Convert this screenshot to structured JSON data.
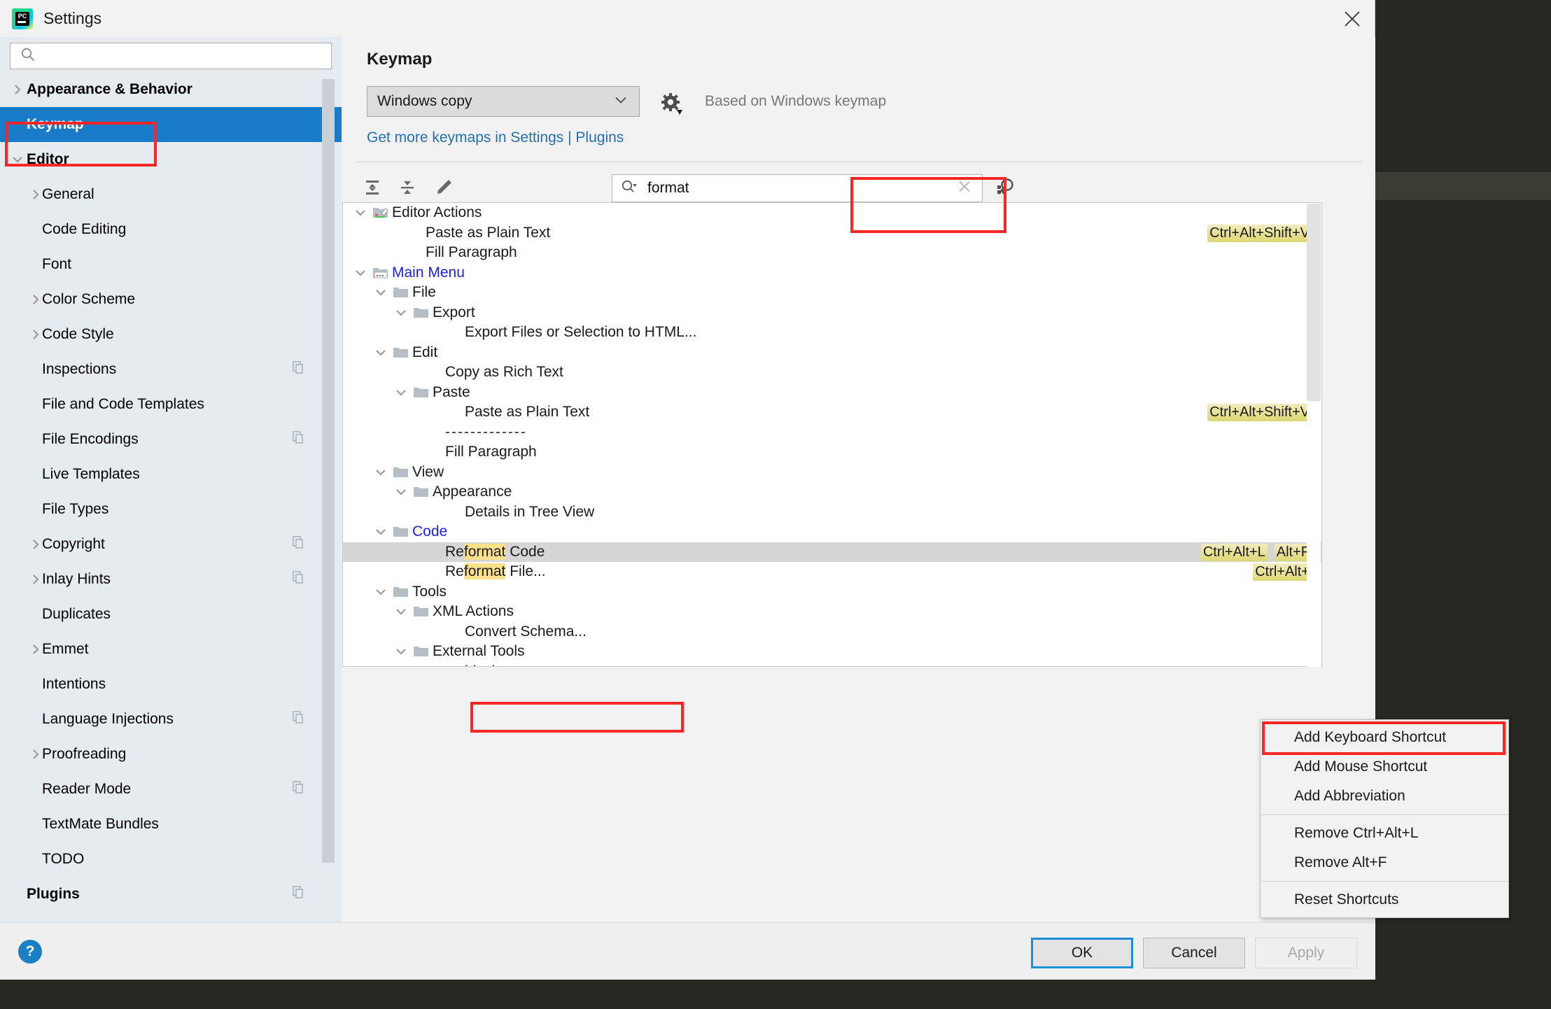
{
  "window": {
    "title": "Settings",
    "logo_text": "PC",
    "close_icon": "close-icon"
  },
  "sidebar": {
    "search": {
      "value": "",
      "placeholder": ""
    },
    "items": [
      {
        "label": "Appearance & Behavior",
        "depth": 0,
        "arrow": "right",
        "bold": true,
        "selected": false,
        "copy": false
      },
      {
        "label": "Keymap",
        "depth": 0,
        "arrow": "none",
        "bold": true,
        "selected": true,
        "copy": false
      },
      {
        "label": "Editor",
        "depth": 0,
        "arrow": "down",
        "bold": true,
        "selected": false,
        "copy": false
      },
      {
        "label": "General",
        "depth": 1,
        "arrow": "right",
        "bold": false,
        "selected": false,
        "copy": false
      },
      {
        "label": "Code Editing",
        "depth": 1,
        "arrow": "none",
        "bold": false,
        "selected": false,
        "copy": false
      },
      {
        "label": "Font",
        "depth": 1,
        "arrow": "none",
        "bold": false,
        "selected": false,
        "copy": false
      },
      {
        "label": "Color Scheme",
        "depth": 1,
        "arrow": "right",
        "bold": false,
        "selected": false,
        "copy": false
      },
      {
        "label": "Code Style",
        "depth": 1,
        "arrow": "right",
        "bold": false,
        "selected": false,
        "copy": false
      },
      {
        "label": "Inspections",
        "depth": 1,
        "arrow": "none",
        "bold": false,
        "selected": false,
        "copy": true
      },
      {
        "label": "File and Code Templates",
        "depth": 1,
        "arrow": "none",
        "bold": false,
        "selected": false,
        "copy": false
      },
      {
        "label": "File Encodings",
        "depth": 1,
        "arrow": "none",
        "bold": false,
        "selected": false,
        "copy": true
      },
      {
        "label": "Live Templates",
        "depth": 1,
        "arrow": "none",
        "bold": false,
        "selected": false,
        "copy": false
      },
      {
        "label": "File Types",
        "depth": 1,
        "arrow": "none",
        "bold": false,
        "selected": false,
        "copy": false
      },
      {
        "label": "Copyright",
        "depth": 1,
        "arrow": "right",
        "bold": false,
        "selected": false,
        "copy": true
      },
      {
        "label": "Inlay Hints",
        "depth": 1,
        "arrow": "right",
        "bold": false,
        "selected": false,
        "copy": true
      },
      {
        "label": "Duplicates",
        "depth": 1,
        "arrow": "none",
        "bold": false,
        "selected": false,
        "copy": false
      },
      {
        "label": "Emmet",
        "depth": 1,
        "arrow": "right",
        "bold": false,
        "selected": false,
        "copy": false
      },
      {
        "label": "Intentions",
        "depth": 1,
        "arrow": "none",
        "bold": false,
        "selected": false,
        "copy": false
      },
      {
        "label": "Language Injections",
        "depth": 1,
        "arrow": "none",
        "bold": false,
        "selected": false,
        "copy": true
      },
      {
        "label": "Proofreading",
        "depth": 1,
        "arrow": "right",
        "bold": false,
        "selected": false,
        "copy": false
      },
      {
        "label": "Reader Mode",
        "depth": 1,
        "arrow": "none",
        "bold": false,
        "selected": false,
        "copy": true
      },
      {
        "label": "TextMate Bundles",
        "depth": 1,
        "arrow": "none",
        "bold": false,
        "selected": false,
        "copy": false
      },
      {
        "label": "TODO",
        "depth": 1,
        "arrow": "none",
        "bold": false,
        "selected": false,
        "copy": false
      },
      {
        "label": "Plugins",
        "depth": 0,
        "arrow": "none",
        "bold": true,
        "selected": false,
        "copy": true
      }
    ]
  },
  "main": {
    "page_title": "Keymap",
    "keymap_select": {
      "value": "Windows copy"
    },
    "gear_icon": "gear-icon",
    "based_on": "Based on Windows keymap",
    "plugins_link": "Get more keymaps in Settings | Plugins",
    "toolbar": {
      "expand_all": "expand-all-icon",
      "collapse_all": "collapse-all-icon",
      "edit": "edit-pencil-icon"
    },
    "search": {
      "value": "format",
      "placeholder": ""
    },
    "find_icon": "find-action-icon",
    "tree": [
      {
        "label": "Editor Actions",
        "depth": 0,
        "arrow": "down",
        "folder": "editor",
        "link": false,
        "selected": false,
        "shortcuts": [],
        "highlight": ""
      },
      {
        "label": "Paste as Plain Text",
        "depth": 2,
        "arrow": "none",
        "folder": "none",
        "link": false,
        "selected": false,
        "shortcuts": [
          "Ctrl+Alt+Shift+V"
        ],
        "highlight": ""
      },
      {
        "label": "Fill Paragraph",
        "depth": 2,
        "arrow": "none",
        "folder": "none",
        "link": false,
        "selected": false,
        "shortcuts": [],
        "highlight": ""
      },
      {
        "label": "Main Menu",
        "depth": 0,
        "arrow": "down",
        "folder": "menu",
        "link": true,
        "selected": false,
        "shortcuts": [],
        "highlight": ""
      },
      {
        "label": "File",
        "depth": 1,
        "arrow": "down",
        "folder": "plain",
        "link": false,
        "selected": false,
        "shortcuts": [],
        "highlight": ""
      },
      {
        "label": "Export",
        "depth": 2,
        "arrow": "down",
        "folder": "plain",
        "link": false,
        "selected": false,
        "shortcuts": [],
        "highlight": ""
      },
      {
        "label": "Export Files or Selection to HTML...",
        "depth": 4,
        "arrow": "none",
        "folder": "none",
        "link": false,
        "selected": false,
        "shortcuts": [],
        "highlight": ""
      },
      {
        "label": "Edit",
        "depth": 1,
        "arrow": "down",
        "folder": "plain",
        "link": false,
        "selected": false,
        "shortcuts": [],
        "highlight": ""
      },
      {
        "label": "Copy as Rich Text",
        "depth": 3,
        "arrow": "none",
        "folder": "none",
        "link": false,
        "selected": false,
        "shortcuts": [],
        "highlight": ""
      },
      {
        "label": "Paste",
        "depth": 2,
        "arrow": "down",
        "folder": "plain",
        "link": false,
        "selected": false,
        "shortcuts": [],
        "highlight": ""
      },
      {
        "label": "Paste as Plain Text",
        "depth": 4,
        "arrow": "none",
        "folder": "none",
        "link": false,
        "selected": false,
        "shortcuts": [
          "Ctrl+Alt+Shift+V"
        ],
        "highlight": ""
      },
      {
        "label": "-------------",
        "depth": 3,
        "arrow": "none",
        "folder": "none",
        "link": false,
        "selected": false,
        "shortcuts": [],
        "highlight": ""
      },
      {
        "label": "Fill Paragraph",
        "depth": 3,
        "arrow": "none",
        "folder": "none",
        "link": false,
        "selected": false,
        "shortcuts": [],
        "highlight": ""
      },
      {
        "label": "View",
        "depth": 1,
        "arrow": "down",
        "folder": "plain",
        "link": false,
        "selected": false,
        "shortcuts": [],
        "highlight": ""
      },
      {
        "label": "Appearance",
        "depth": 2,
        "arrow": "down",
        "folder": "plain",
        "link": false,
        "selected": false,
        "shortcuts": [],
        "highlight": ""
      },
      {
        "label": "Details in Tree View",
        "depth": 4,
        "arrow": "none",
        "folder": "none",
        "link": false,
        "selected": false,
        "shortcuts": [],
        "highlight": ""
      },
      {
        "label": "Code",
        "depth": 1,
        "arrow": "down",
        "folder": "plain",
        "link": true,
        "selected": false,
        "shortcuts": [],
        "highlight": ""
      },
      {
        "label": "Reformat Code",
        "depth": 3,
        "arrow": "none",
        "folder": "none",
        "link": false,
        "selected": true,
        "shortcuts": [
          "Ctrl+Alt+L",
          "Alt+F"
        ],
        "highlight": "format"
      },
      {
        "label": "Reformat File...",
        "depth": 3,
        "arrow": "none",
        "folder": "none",
        "link": false,
        "selected": false,
        "shortcuts": [
          "Ctrl+Alt+"
        ],
        "highlight": "format"
      },
      {
        "label": "Tools",
        "depth": 1,
        "arrow": "down",
        "folder": "plain",
        "link": false,
        "selected": false,
        "shortcuts": [],
        "highlight": ""
      },
      {
        "label": "XML Actions",
        "depth": 2,
        "arrow": "down",
        "folder": "plain",
        "link": false,
        "selected": false,
        "shortcuts": [],
        "highlight": ""
      },
      {
        "label": "Convert Schema...",
        "depth": 4,
        "arrow": "none",
        "folder": "none",
        "link": false,
        "selected": false,
        "shortcuts": [],
        "highlight": ""
      },
      {
        "label": "External Tools",
        "depth": 2,
        "arrow": "down",
        "folder": "plain",
        "link": false,
        "selected": false,
        "shortcuts": [],
        "highlight": ""
      },
      {
        "label": "black",
        "depth": 4,
        "arrow": "none",
        "folder": "none",
        "link": false,
        "selected": false,
        "shortcuts": [],
        "highlight": ""
      }
    ]
  },
  "context_menu": {
    "items": [
      {
        "label": "Add Keyboard Shortcut",
        "separator_after": false
      },
      {
        "label": "Add Mouse Shortcut",
        "separator_after": false
      },
      {
        "label": "Add Abbreviation",
        "separator_after": true
      },
      {
        "label": "Remove Ctrl+Alt+L",
        "separator_after": false
      },
      {
        "label": "Remove Alt+F",
        "separator_after": true
      },
      {
        "label": "Reset Shortcuts",
        "separator_after": false
      }
    ]
  },
  "footer": {
    "help_label": "?",
    "ok_label": "OK",
    "cancel_label": "Cancel",
    "apply_label": "Apply"
  },
  "colors": {
    "accent_blue": "#187cc9",
    "link_blue": "#2470b3",
    "annotation_red": "#f82626",
    "highlight_yellow": "#fde08a",
    "shortcut_yellow": "#ddd872"
  }
}
